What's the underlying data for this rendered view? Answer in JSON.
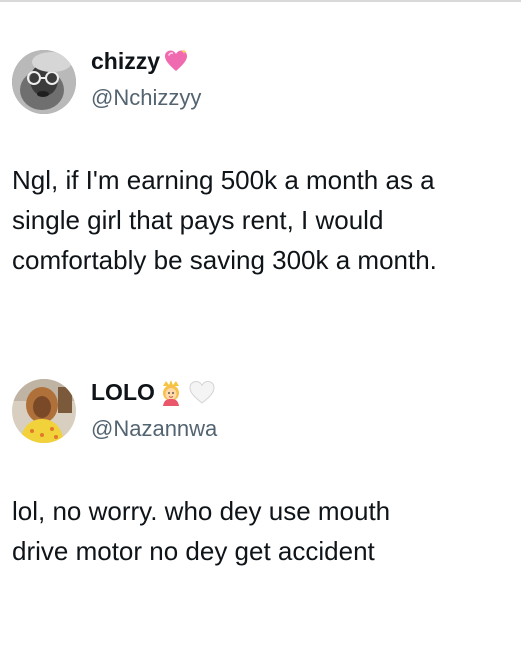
{
  "tweets": [
    {
      "display_name": "chizzy",
      "name_emojis": [
        "sparkling-heart-icon"
      ],
      "handle": "@Nchizzyy",
      "text_lines": [
        "Ngl, if I'm earning 500k a month as a",
        "single girl that pays rent, I would",
        "comfortably be saving 300k a month."
      ]
    },
    {
      "display_name": "LOLO",
      "name_emojis": [
        "princess-icon",
        "white-heart-icon"
      ],
      "handle": "@Nazannwa",
      "text_lines": [
        "lol, no worry. who dey use mouth",
        "drive motor no dey get accident"
      ]
    }
  ],
  "colors": {
    "name": "#0f1419",
    "handle": "#536471",
    "text": "#0f1419",
    "heart_pink": "#f06ab0"
  }
}
